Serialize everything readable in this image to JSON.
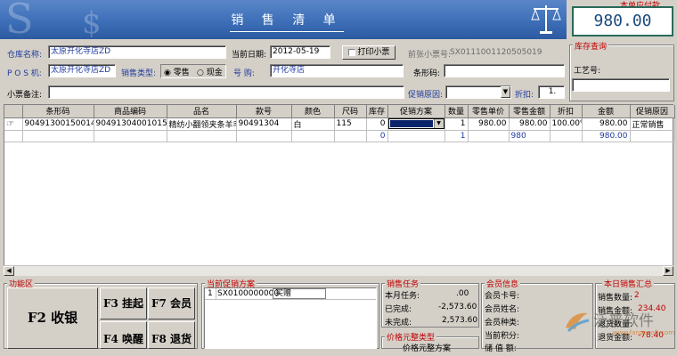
{
  "header": {
    "title": "销 售 清 单"
  },
  "total": {
    "label": "本单应付款",
    "value": "980.00"
  },
  "form": {
    "warehouse_label": "仓库名称:",
    "warehouse_value": "太原开化寺店ZD",
    "date_label": "当前日期:",
    "date_value": "2012-05-19",
    "print_label": "打印小票",
    "prev_receipt_label": "前张小票号:",
    "prev_receipt_value": "SX0111001120505019",
    "pos_label": "P O S 机:",
    "pos_value": "太原开化寺店ZD",
    "sale_type_label": "销售类型:",
    "sale_type_options": [
      "零售",
      "现金"
    ],
    "shop_label": "号 购:",
    "shop_value": "开化寺店",
    "barcode_label": "条形码:",
    "barcode_value": "",
    "note_label": "小票备注:",
    "note_value": "",
    "promo_reason_label": "促销原因:",
    "promo_reason_value": "",
    "discount_label": "折扣:",
    "discount_value": "1."
  },
  "stock_query": {
    "title": "库存查询",
    "craft_label": "工艺号:",
    "craft_value": ""
  },
  "table": {
    "columns": [
      "",
      "条形码",
      "商品编码",
      "品名",
      "款号",
      "颜色",
      "尺码",
      "库存",
      "促销方案",
      "数量",
      "零售单价",
      "零售金额",
      "折扣",
      "金额",
      "促销原因"
    ],
    "row": [
      "90491300150014",
      "90491304001015",
      "精纺小翻领夹条羊毛衫",
      "90491304",
      "白",
      "115",
      "0",
      "",
      "1",
      "980.00",
      "980.00",
      "100.00%",
      "980.00",
      "正常销售"
    ],
    "summary": {
      "stock": "0",
      "qty": "1",
      "retail_amount": "980",
      "amount": "980.00"
    }
  },
  "bottom": {
    "func_title": "功能区",
    "keys": {
      "f2": "F2 收银",
      "f3": "F3 挂起",
      "f7": "F7 会员",
      "f4": "F4 唤醒",
      "f8": "F8 退货"
    },
    "promo_title": "当前促销方案",
    "promo_row": {
      "index": "1",
      "code": "SX0100000000",
      "name": "买赠"
    },
    "task_title": "销售任务",
    "task": [
      {
        "label": "本月任务:",
        "value": ".00"
      },
      {
        "label": "已完成:",
        "value": "-2,573.60"
      },
      {
        "label": "未完成:",
        "value": "2,573.60"
      }
    ],
    "coupon_title": "价格元整类型",
    "coupon_text": "价格元整方案",
    "member_title": "会员信息",
    "member": [
      "会员卡号:",
      "会员姓名:",
      "会员种类:",
      "当前积分:",
      "储 值 额:"
    ],
    "daily_title": "本日销售汇总",
    "daily": [
      {
        "label": "销售数量:",
        "value": "2"
      },
      {
        "label": "销售金额:",
        "value": "234.40"
      },
      {
        "label": "退货数量:",
        "value": ""
      },
      {
        "label": "退货金额:",
        "value": "-78.40"
      }
    ],
    "watermark": "泛普软件",
    "watermark_sub": "www.fanpusoft.com"
  }
}
